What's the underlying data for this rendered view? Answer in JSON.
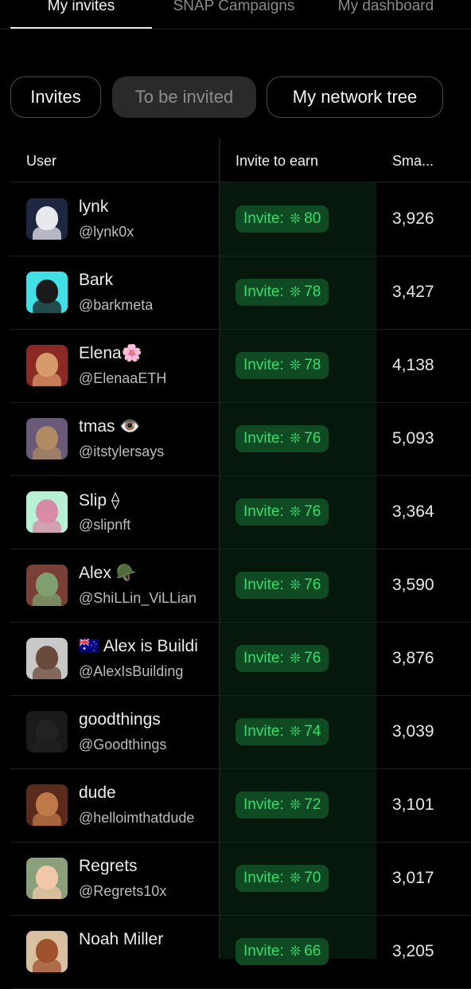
{
  "tabs": [
    {
      "label": "My invites",
      "active": true
    },
    {
      "label": "SNAP Campaigns",
      "active": false
    },
    {
      "label": "My dashboard",
      "active": false
    }
  ],
  "filters": [
    {
      "label": "Invites",
      "selected": false
    },
    {
      "label": "To be invited",
      "selected": true
    },
    {
      "label": "My network tree",
      "selected": false
    }
  ],
  "table": {
    "headers": {
      "user": "User",
      "invite": "Invite to earn",
      "score": "Sma..."
    },
    "invite_prefix": "Invite:",
    "gem_icon": "❊",
    "rows": [
      {
        "name": "lynk",
        "handle": "@lynk0x",
        "invite": "80",
        "score": "3,926",
        "avatar_bg": "#1d2740",
        "avatar_fg": "#e8e8ef"
      },
      {
        "name": "Bark",
        "handle": "@barkmeta",
        "invite": "78",
        "score": "3,427",
        "avatar_bg": "#3fe0e6",
        "avatar_fg": "#1a1a1a"
      },
      {
        "name": "Elena🌸",
        "handle": "@ElenaaETH",
        "invite": "78",
        "score": "4,138",
        "avatar_bg": "#8a2a22",
        "avatar_fg": "#d79a6a"
      },
      {
        "name": "tmas 👁️",
        "handle": "@itstylersays",
        "invite": "76",
        "score": "5,093",
        "avatar_bg": "#6a5a7a",
        "avatar_fg": "#b08a62"
      },
      {
        "name": "Slip ⟠",
        "handle": "@slipnft",
        "invite": "76",
        "score": "3,364",
        "avatar_bg": "#b8f0d6",
        "avatar_fg": "#d88aa6"
      },
      {
        "name": "Alex 🪖",
        "handle": "@ShiLLin_ViLLian",
        "invite": "76",
        "score": "3,590",
        "avatar_bg": "#7a4036",
        "avatar_fg": "#7ea06e"
      },
      {
        "name": "🇦🇺 Alex is Buildi",
        "handle": "@AlexIsBuilding",
        "invite": "76",
        "score": "3,876",
        "avatar_bg": "#c8c8c8",
        "avatar_fg": "#6a4a3a"
      },
      {
        "name": "goodthings",
        "handle": "@Goodthings",
        "invite": "74",
        "score": "3,039",
        "avatar_bg": "#1a1a1a",
        "avatar_fg": "#222222"
      },
      {
        "name": "dude",
        "handle": "@helloimthatdude",
        "invite": "72",
        "score": "3,101",
        "avatar_bg": "#5a2a1a",
        "avatar_fg": "#c07a4a"
      },
      {
        "name": "Regrets",
        "handle": "@Regrets10x",
        "invite": "70",
        "score": "3,017",
        "avatar_bg": "#8aa07a",
        "avatar_fg": "#f0c8a8"
      },
      {
        "name": "Noah Miller",
        "handle": "",
        "invite": "66",
        "score": "3,205",
        "avatar_bg": "#d8c0a0",
        "avatar_fg": "#a0522d"
      }
    ]
  }
}
